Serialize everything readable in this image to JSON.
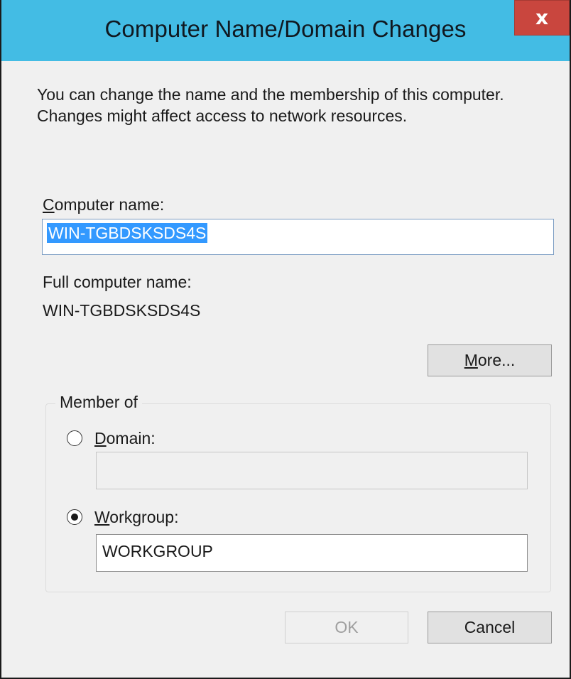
{
  "window": {
    "title": "Computer Name/Domain Changes",
    "close_glyph": "x",
    "close_icon": "close-icon"
  },
  "description": "You can change the name and the membership of this computer. Changes might affect access to network resources.",
  "computer_name": {
    "label_accel": "C",
    "label_rest": "omputer name:",
    "value": "WIN-TGBDSKSDS4S"
  },
  "full_computer_name": {
    "label": "Full computer name:",
    "value": "WIN-TGBDSKSDS4S"
  },
  "more_button": {
    "label_accel": "M",
    "label_rest": "ore..."
  },
  "member_of": {
    "legend": "Member of",
    "selected": "workgroup",
    "domain": {
      "label_accel": "D",
      "label_rest": "omain:",
      "value": ""
    },
    "workgroup": {
      "label_accel": "W",
      "label_rest": "orkgroup:",
      "value": "WORKGROUP"
    }
  },
  "buttons": {
    "ok": "OK",
    "cancel": "Cancel"
  },
  "colors": {
    "titlebar": "#43bce4",
    "close": "#c9463e",
    "selection": "#3399ff"
  }
}
